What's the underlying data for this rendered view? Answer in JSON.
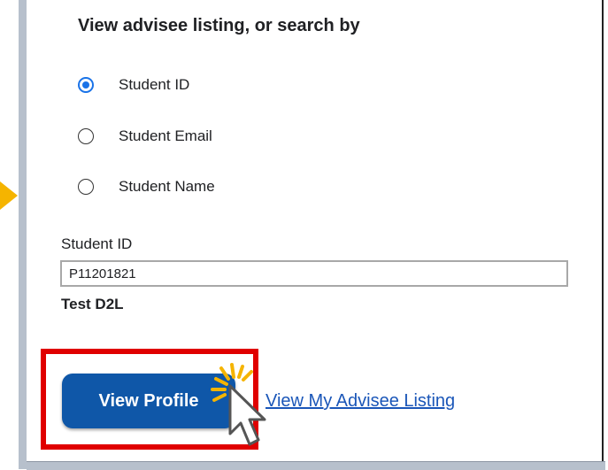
{
  "search": {
    "heading": "View advisee listing, or search by",
    "options": [
      {
        "label": "Student ID",
        "checked": true
      },
      {
        "label": "Student Email",
        "checked": false
      },
      {
        "label": "Student Name",
        "checked": false
      }
    ]
  },
  "field": {
    "label": "Student ID",
    "value": "P11201821"
  },
  "result": {
    "name": "Test D2L"
  },
  "actions": {
    "view_profile": "View Profile",
    "view_listing": "View My Advisee Listing"
  },
  "colors": {
    "accent": "#1a73e8",
    "button": "#0f57a8",
    "highlight": "#e00000",
    "pointer_arrow": "#f5b400"
  },
  "icons": {
    "cursor": "mouse-pointer-icon",
    "click_burst": "click-burst-icon",
    "pointer_arrow": "arrow-right-icon"
  }
}
